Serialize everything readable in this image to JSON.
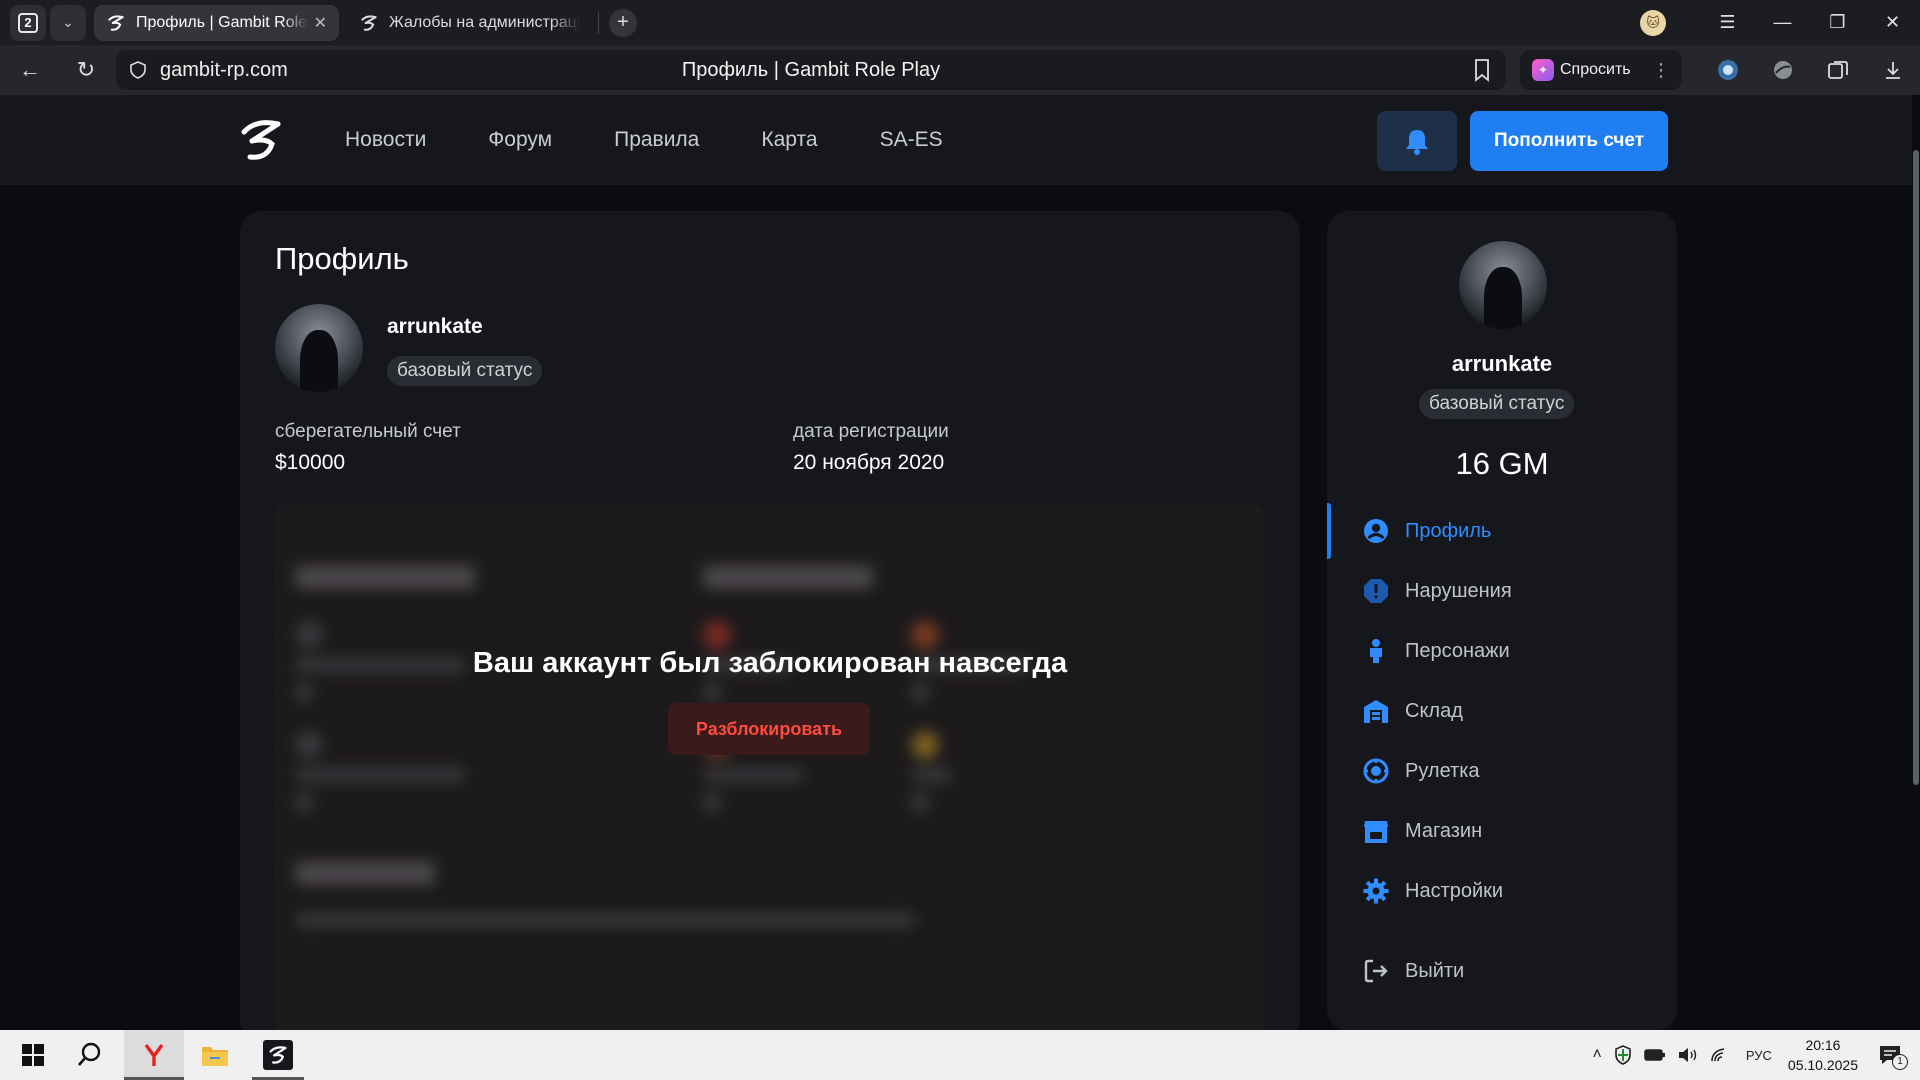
{
  "browser": {
    "tab_count": "2",
    "tabs": [
      {
        "title": "Профиль | Gambit Role Play"
      },
      {
        "title": "Жалобы на администрацию"
      }
    ],
    "url": "gambit-rp.com",
    "page_title": "Профиль | Gambit Role Play",
    "ask_label": "Спросить"
  },
  "site": {
    "nav": [
      "Новости",
      "Форум",
      "Правила",
      "Карта",
      "SA-ES"
    ],
    "topup_label": "Пополнить счет"
  },
  "profile": {
    "title": "Профиль",
    "username": "arrunkate",
    "status": "базовый статус",
    "savings_label": "сберегательный счет",
    "savings_value": "$10000",
    "reg_label": "дата регистрации",
    "reg_value": "20 ноября 2020",
    "ban_message": "Ваш аккаунт был заблокирован навсегда",
    "unban_label": "Разблокировать"
  },
  "sidebar": {
    "username": "arrunkate",
    "status": "базовый статус",
    "balance": "16 GM",
    "menu": [
      {
        "label": "Профиль",
        "icon": "user-circle-icon",
        "active": true
      },
      {
        "label": "Нарушения",
        "icon": "warning-hexagon-icon"
      },
      {
        "label": "Персонажи",
        "icon": "person-icon"
      },
      {
        "label": "Склад",
        "icon": "warehouse-icon"
      },
      {
        "label": "Рулетка",
        "icon": "roulette-icon"
      },
      {
        "label": "Магазин",
        "icon": "shop-icon"
      },
      {
        "label": "Настройки",
        "icon": "gear-icon"
      }
    ],
    "logout_label": "Выйти"
  },
  "taskbar": {
    "lang": "РУС",
    "time": "20:16",
    "date": "05.10.2025",
    "notification_count": "1"
  },
  "colors": {
    "accent": "#1e7ef2",
    "danger": "#ff4a3d",
    "card_bg": "#15171c",
    "page_bg": "#0b0c0f"
  }
}
